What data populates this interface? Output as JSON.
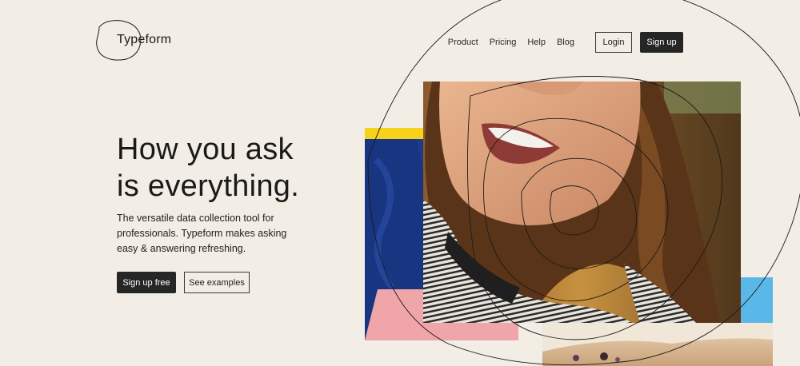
{
  "brand": {
    "name": "Typeform"
  },
  "nav": {
    "links": [
      "Product",
      "Pricing",
      "Help",
      "Blog"
    ],
    "login_label": "Login",
    "signup_label": "Sign up"
  },
  "hero": {
    "title": "How you ask\nis everything.",
    "subtitle": "The versatile data collection tool for professionals. Typeform makes asking easy & answering refreshing.",
    "primary_cta": "Sign up free",
    "secondary_cta": "See examples"
  },
  "colors": {
    "background": "#f2ede5",
    "dark": "#262626",
    "yellow_block": "#f7d21a",
    "blue_block": "#1c3b8c",
    "pink_block": "#f0a5a8",
    "sky_block": "#5ab8e8"
  }
}
